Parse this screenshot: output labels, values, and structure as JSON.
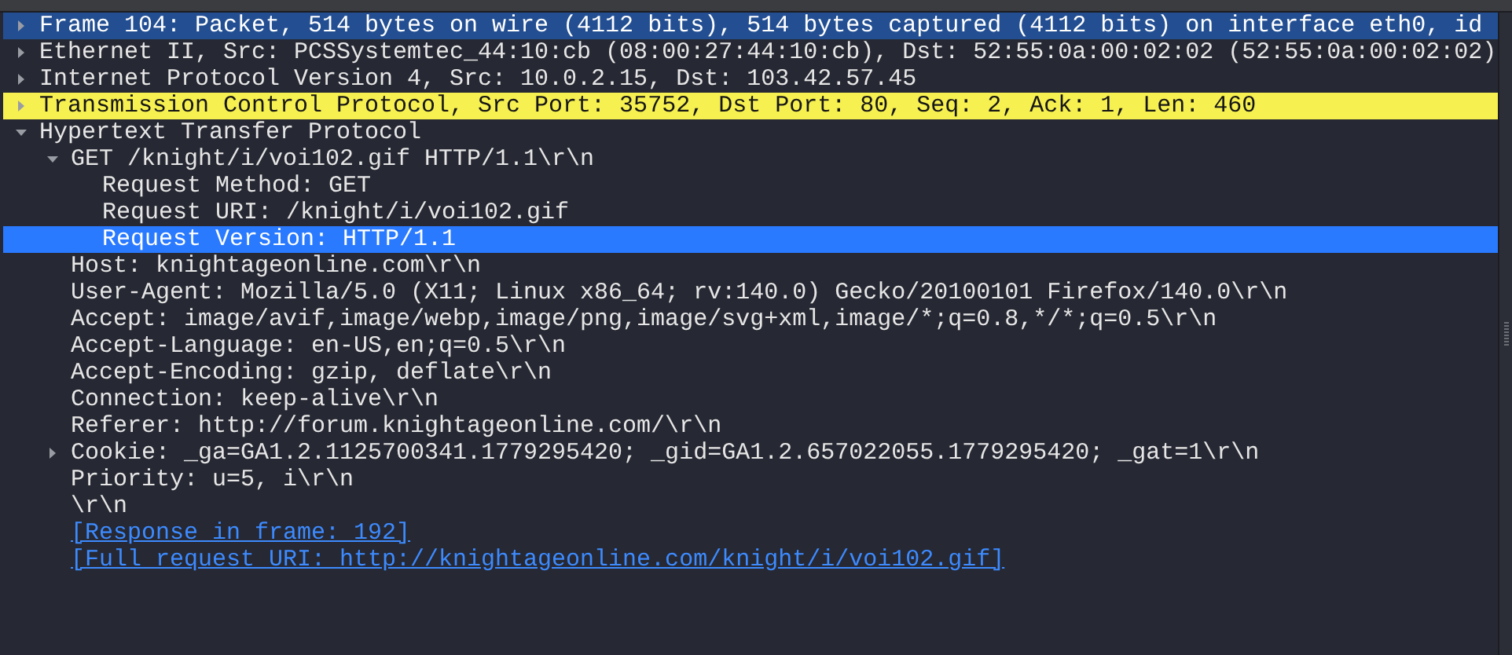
{
  "rows": [
    {
      "text": "Frame 104: Packet, 514 bytes on wire (4112 bits), 514 bytes captured (4112 bits) on interface eth0, id",
      "expanded": false,
      "selected": false,
      "color": "#234f92"
    },
    {
      "text": "Ethernet II, Src: PCSSystemtec_44:10:cb (08:00:27:44:10:cb), Dst: 52:55:0a:00:02:02 (52:55:0a:00:02:02)",
      "expanded": false,
      "selected": false
    },
    {
      "text": "Internet Protocol Version 4, Src: 10.0.2.15, Dst: 103.42.57.45",
      "expanded": false,
      "selected": false
    },
    {
      "text": "Transmission Control Protocol, Src Port: 35752, Dst Port: 80, Seq: 2, Ack: 1, Len: 460",
      "expanded": false,
      "selected": false,
      "color": "#f6f051"
    },
    {
      "text": "Hypertext Transfer Protocol",
      "expanded": true,
      "selected": false,
      "children": [
        {
          "text": "GET /knight/i/voi102.gif HTTP/1.1\\r\\n",
          "expanded": true,
          "selected": false,
          "children": [
            {
              "text": "Request Method: GET",
              "selected": false
            },
            {
              "text": "Request URI: /knight/i/voi102.gif",
              "selected": false
            },
            {
              "text": "Request Version: HTTP/1.1",
              "selected": true
            }
          ]
        },
        {
          "text": "Host: knightageonline.com\\r\\n",
          "selected": false
        },
        {
          "text": "User-Agent: Mozilla/5.0 (X11; Linux x86_64; rv:140.0) Gecko/20100101 Firefox/140.0\\r\\n",
          "selected": false
        },
        {
          "text": "Accept: image/avif,image/webp,image/png,image/svg+xml,image/*;q=0.8,*/*;q=0.5\\r\\n",
          "selected": false
        },
        {
          "text": "Accept-Language: en-US,en;q=0.5\\r\\n",
          "selected": false
        },
        {
          "text": "Accept-Encoding: gzip, deflate\\r\\n",
          "selected": false
        },
        {
          "text": "Connection: keep-alive\\r\\n",
          "selected": false
        },
        {
          "text": "Referer: http://forum.knightageonline.com/\\r\\n",
          "selected": false
        },
        {
          "text": "Cookie: _ga=GA1.2.1125700341.1779295420; _gid=GA1.2.657022055.1779295420; _gat=1\\r\\n",
          "expanded": false,
          "selected": false
        },
        {
          "text": "Priority: u=5, i\\r\\n",
          "selected": false
        },
        {
          "text": "\\r\\n",
          "selected": false
        },
        {
          "text": "[Response in frame: 192]",
          "kind": "link",
          "selected": false
        },
        {
          "text": "[Full request URI: http://knightageonline.com/knight/i/voi102.gif]",
          "kind": "link",
          "selected": false
        }
      ]
    }
  ]
}
